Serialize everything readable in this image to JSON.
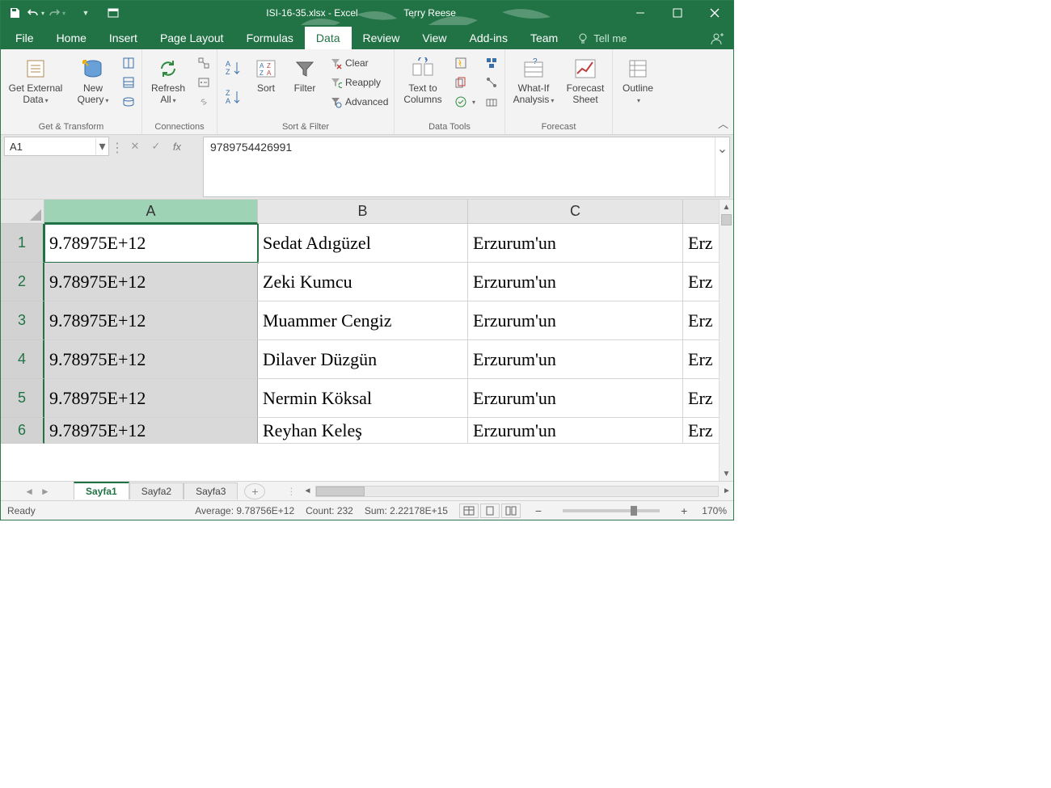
{
  "title_bar": {
    "document_title": "ISI-16-35.xlsx - Excel",
    "user_name": "Terry Reese"
  },
  "ribbon_tabs": {
    "file": "File",
    "home": "Home",
    "insert": "Insert",
    "page_layout": "Page Layout",
    "formulas": "Formulas",
    "data": "Data",
    "review": "Review",
    "view": "View",
    "addins": "Add-ins",
    "team": "Team",
    "tell_me": "Tell me"
  },
  "ribbon": {
    "get_transform": {
      "get_external": "Get External Data",
      "new_query": "New Query",
      "label": "Get & Transform"
    },
    "connections": {
      "refresh_all": "Refresh All",
      "label": "Connections"
    },
    "sort_filter": {
      "sort": "Sort",
      "filter": "Filter",
      "clear": "Clear",
      "reapply": "Reapply",
      "advanced": "Advanced",
      "label": "Sort & Filter"
    },
    "data_tools": {
      "text_to_columns": "Text to Columns",
      "label": "Data Tools"
    },
    "forecast": {
      "what_if": "What-If Analysis",
      "forecast_sheet": "Forecast Sheet",
      "label": "Forecast"
    },
    "outline": {
      "outline": "Outline"
    }
  },
  "name_box": {
    "value": "A1"
  },
  "formula_bar": {
    "value": "9789754426991"
  },
  "columns": {
    "A": "A",
    "B": "B",
    "C": "C"
  },
  "col_widths": {
    "A": 264,
    "B": 260,
    "C": 266,
    "D": 46
  },
  "rows": [
    {
      "n": "1",
      "A": "9.78975E+12",
      "B": "Sedat Adıgüzel",
      "C": "Erzurum'un",
      "D": "Erz"
    },
    {
      "n": "2",
      "A": "9.78975E+12",
      "B": "Zeki Kumcu",
      "C": "Erzurum'un",
      "D": "Erz"
    },
    {
      "n": "3",
      "A": "9.78975E+12",
      "B": "Muammer Cengiz",
      "C": "Erzurum'un",
      "D": "Erz"
    },
    {
      "n": "4",
      "A": "9.78975E+12",
      "B": "Dilaver Düzgün",
      "C": "Erzurum'un",
      "D": "Erz"
    },
    {
      "n": "5",
      "A": "9.78975E+12",
      "B": "Nermin Köksal",
      "C": "Erzurum'un",
      "D": "Erz"
    },
    {
      "n": "6",
      "A": "9.78975E+12",
      "B": "Reyhan Keleş",
      "C": "Erzurum'un",
      "D": "Erz"
    }
  ],
  "sheets": {
    "s1": "Sayfa1",
    "s2": "Sayfa2",
    "s3": "Sayfa3"
  },
  "status": {
    "ready": "Ready",
    "average": "Average: 9.78756E+12",
    "count": "Count: 232",
    "sum": "Sum: 2.22178E+15",
    "zoom": "170%"
  }
}
